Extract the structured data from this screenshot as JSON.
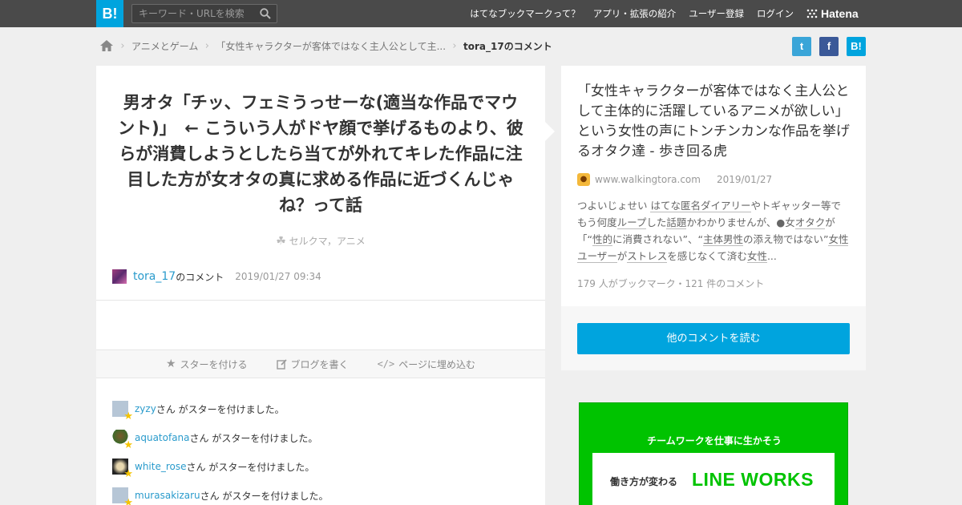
{
  "topbar": {
    "logo": "B!",
    "search_placeholder": "キーワード・URLを検索",
    "nav": [
      "はてなブックマークって？",
      "アプリ・拡張の紹介",
      "ユーザー登録",
      "ログイン"
    ],
    "brand": "Hatena"
  },
  "breadcrumb": {
    "items": [
      "アニメとゲーム",
      "「女性キャラクターが客体ではなく主人公として主..."
    ],
    "current": "tora_17のコメント"
  },
  "social": {
    "twitter": "t",
    "facebook": "f",
    "hatena": "B!"
  },
  "comment": {
    "text": "男オタ「チッ、フェミうっせーな(適当な作品でマウント)」　← こういう人がドヤ顔で挙げるものより、彼らが消費しようとしたら当てが外れてキレた作品に注目した方が女オタの真に求める作品に近づくんじゃね？って話",
    "tags": "セルクマ，アニメ",
    "user": "tora_17",
    "user_suffix": "のコメント",
    "date": "2019/01/27 09:34"
  },
  "actions": {
    "star": "スターを付ける",
    "blog": "ブログを書く",
    "embed": "ページに埋め込む"
  },
  "stars": [
    {
      "name": "zyzy",
      "suffix": "さん がスターを付けました。"
    },
    {
      "name": "aquatofana",
      "suffix": "さん がスターを付けました。"
    },
    {
      "name": "white_rose",
      "suffix": "さん がスターを付けました。"
    },
    {
      "name": "murasakizaru",
      "suffix": "さん がスターを付けました。"
    }
  ],
  "entry": {
    "title": "「女性キャラクターが客体ではなく主人公として主体的に活躍しているアニメが欲しい」という女性の声にトンチンカンな作品を挙げるオタク達 - 歩き回る虎",
    "site": "www.walkingtora.com",
    "date": "2019/01/27",
    "summary": {
      "s1": "つよいじょせい ",
      "u1": "はてな匿名ダイアリー",
      "s2": "やトギャッター等でもう何度",
      "u2": "ループ",
      "s3": "した",
      "u3": "話題",
      "s4": "かわかりませんが、●女",
      "u4": "オタク",
      "s5": "が「“",
      "u5": "性的",
      "s6": "に消費されない”、“",
      "u6": "主体",
      "u7": "男性",
      "s7": "の添え物ではない”",
      "u8": "女性",
      "u9": "ユーザー",
      "s8": "が",
      "u10": "ストレス",
      "s9": "を感じなくて済む",
      "u11": "女性",
      "s10": "..."
    },
    "counts": "179 人がブックマーク・121 件のコメント",
    "read_more": "他のコメントを読む"
  },
  "ad": {
    "headline": "チームワークを仕事に生かそう",
    "sub": "働き方が変わる",
    "brand": "LINE WORKS"
  }
}
